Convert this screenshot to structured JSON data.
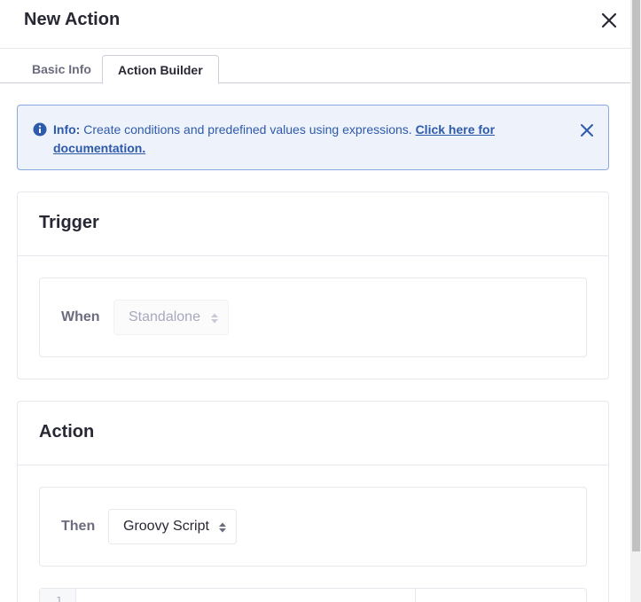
{
  "modal": {
    "title": "New Action",
    "close_icon": "close-icon"
  },
  "tabs": [
    {
      "label": "Basic Info",
      "active": false
    },
    {
      "label": "Action Builder",
      "active": true
    }
  ],
  "alert": {
    "icon": "info-circle-icon",
    "lead": "Info:",
    "text": " Create conditions and predefined values using expressions. ",
    "link_text": "Click here for documentation.",
    "close_icon": "close-icon"
  },
  "trigger": {
    "title": "Trigger",
    "field_label": "When",
    "select_value": "Standalone",
    "disabled": true
  },
  "action": {
    "title": "Action",
    "field_label": "Then",
    "select_value": "Groovy Script"
  },
  "code_editor": {
    "line_numbers": [
      "1"
    ]
  },
  "colors": {
    "alert_bg": "#eef2fa",
    "alert_border": "#89a7e0",
    "alert_text": "#2e5aac",
    "border": "#e7e7ed",
    "label": "#6b6c7e"
  }
}
